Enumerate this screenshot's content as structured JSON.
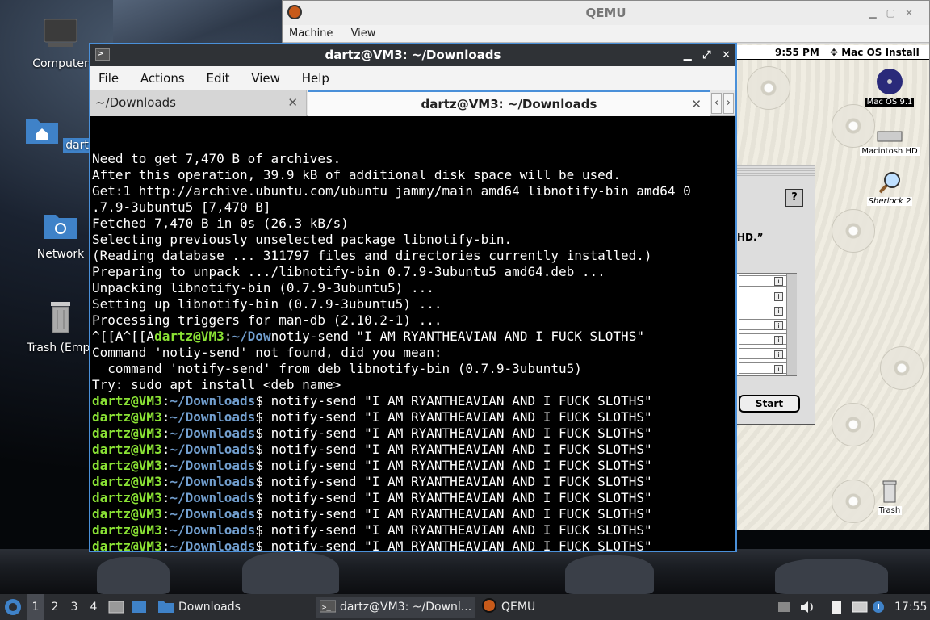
{
  "desktop": {
    "icons": [
      {
        "name": "computer",
        "label": "Computer"
      },
      {
        "name": "home",
        "label": "dartz"
      },
      {
        "name": "network",
        "label": "Network"
      },
      {
        "name": "trash",
        "label": "Trash (Empt"
      }
    ]
  },
  "qemu": {
    "title": "QEMU",
    "menu": [
      "Machine",
      "View"
    ],
    "mac": {
      "menubar_time": "9:55 PM",
      "menubar_app": "Mac OS Install",
      "icons": {
        "macos": "Mac OS 9.1",
        "hd": "Macintosh HD",
        "sherlock": "Sherlock 2",
        "trash": "Trash"
      },
      "dialog_text": "HD.”",
      "start_label": "Start"
    }
  },
  "terminal": {
    "title": "dartz@VM3: ~/Downloads",
    "menu": [
      "File",
      "Actions",
      "Edit",
      "View",
      "Help"
    ],
    "tabs": [
      {
        "label": "~/Downloads",
        "active": false
      },
      {
        "label": "dartz@VM3: ~/Downloads",
        "active": true
      }
    ],
    "prompt_user": "dartz@VM3",
    "prompt_path": "~/Downloads",
    "output_lines": [
      "Need to get 7,470 B of archives.",
      "After this operation, 39.9 kB of additional disk space will be used.",
      "Get:1 http://archive.ubuntu.com/ubuntu jammy/main amd64 libnotify-bin amd64 0",
      ".7.9-3ubuntu5 [7,470 B]",
      "Fetched 7,470 B in 0s (26.3 kB/s)",
      "Selecting previously unselected package libnotify-bin.",
      "(Reading database ... 311797 files and directories currently installed.)",
      "Preparing to unpack .../libnotify-bin_0.7.9-3ubuntu5_amd64.deb ...",
      "Unpacking libnotify-bin (0.7.9-3ubuntu5) ...",
      "Setting up libnotify-bin (0.7.9-3ubuntu5) ...",
      "Processing triggers for man-db (2.10.2-1) ..."
    ],
    "garbled_prefix": "^[[A^[[A",
    "garbled_path": "~/Dow",
    "garbled_cmd": "notiy-send \"I AM RYANTHEAVIAN AND I FUCK SLOTHS\"",
    "error_lines": [
      "Command 'notiy-send' not found, did you mean:",
      "  command 'notify-send' from deb libnotify-bin (0.7.9-3ubuntu5)",
      "Try: sudo apt install <deb name>"
    ],
    "commands": [
      "notify-send \"I AM RYANTHEAVIAN AND I FUCK SLOTHS\"",
      "notify-send \"I AM RYANTHEAVIAN AND I FUCK SLOTHS\"",
      "notify-send \"I AM RYANTHEAVIAN AND I FUCK SLOTHS\"",
      "notify-send \"I AM RYANTHEAVIAN AND I FUCK SLOTHS\"",
      "notify-send \"I AM RYANTHEAVIAN AND I FUCK SLOTHS\"",
      "notify-send \"I AM RYANTHEAVIAN AND I FUCK SLOTHS\"",
      "notify-send \"I AM RYANTHEAVIAN AND I FUCK SLOTHS\"",
      "notify-send \"I AM RYANTHEAVIAN AND I FUCK SLOTHS\"",
      "notify-send \"I AM RYANTHEAVIAN AND I FUCK SLOTHS\"",
      "notify-send \"I AM RYANTHEAVIAN AND I FUCK SLOTHS\""
    ],
    "colors": {
      "user": "#8ae234",
      "path": "#729fcf",
      "focus_border": "#4a90d9"
    }
  },
  "taskbar": {
    "workspaces": [
      "1",
      "2",
      "3",
      "4"
    ],
    "active_workspace": "1",
    "tasks": [
      {
        "label": "Downloads",
        "icon": "folder-icon"
      },
      {
        "label": "dartz@VM3: ~/Downl...",
        "icon": "terminal-icon"
      },
      {
        "label": "QEMU",
        "icon": "qemu-icon"
      }
    ],
    "clock": "17:55"
  }
}
